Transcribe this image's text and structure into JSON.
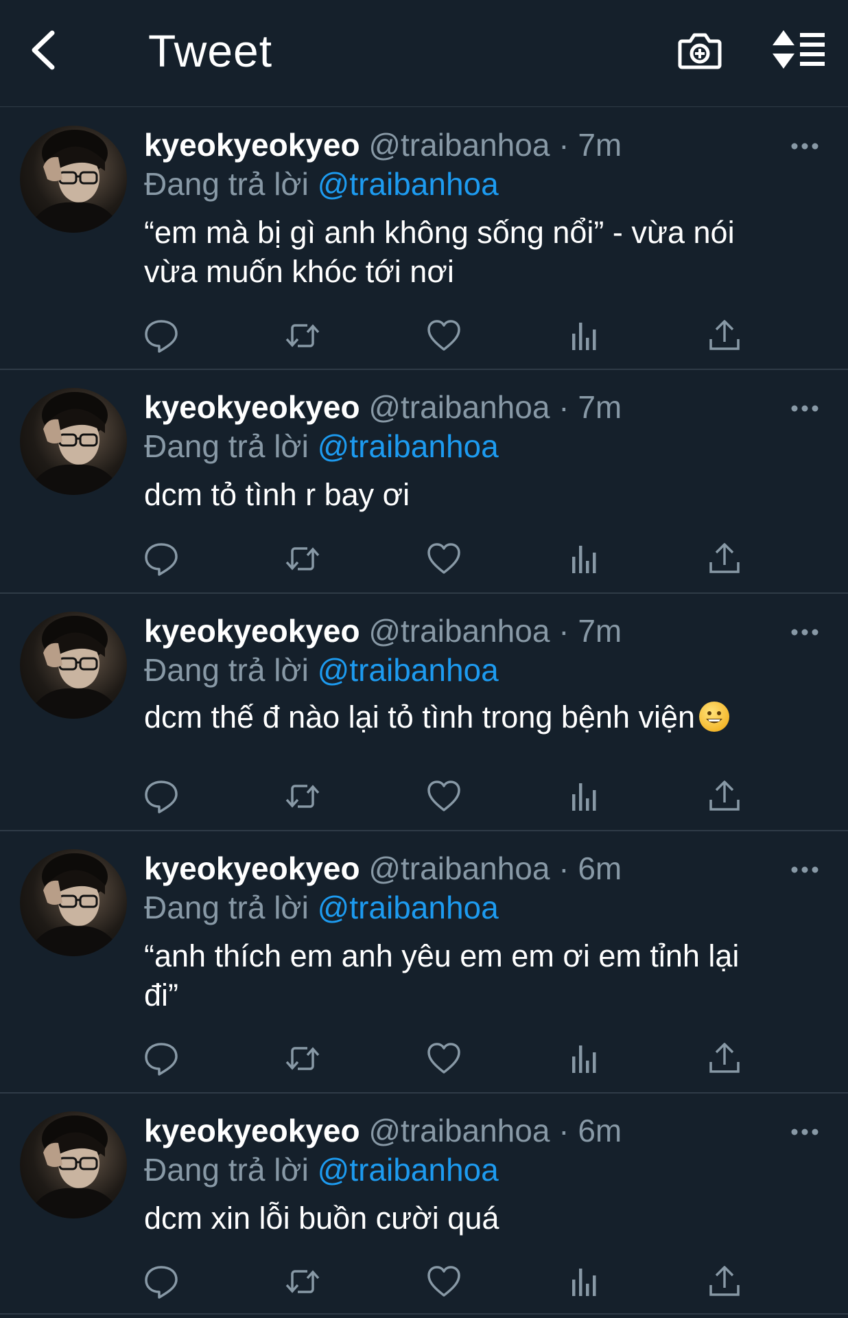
{
  "header": {
    "title": "Tweet",
    "icons": [
      "back-arrow-icon",
      "camera-plus-icon",
      "sort-timeline-icon"
    ]
  },
  "colors": {
    "background": "#15202b",
    "divider": "#2f3b47",
    "secondary_text": "#8899a6",
    "accent": "#1d9bf0"
  },
  "tweets": [
    {
      "name": "kyeokyeokyeo",
      "handle": "@traibanhoa",
      "time": "· 7m",
      "reply_prefix": "Đang trả lời",
      "reply_to": "@traibanhoa",
      "text_lines": [
        "“em mà bị gì anh không sống nổi” - vừa nói",
        "vừa muốn khóc tới nơi"
      ]
    },
    {
      "name": "kyeokyeokyeo",
      "handle": "@traibanhoa",
      "time": "· 7m",
      "reply_prefix": "Đang trả lời",
      "reply_to": "@traibanhoa",
      "text_lines": [
        "dcm tỏ tình r bay ơi"
      ]
    },
    {
      "name": "kyeokyeokyeo",
      "handle": "@traibanhoa",
      "time": "· 7m",
      "reply_prefix": "Đang trả lời",
      "reply_to": "@traibanhoa",
      "text_lines": [
        "dcm thế đ nào lại tỏ tình trong bệnh viện"
      ],
      "emoji": "grinning-face-emoji"
    },
    {
      "name": "kyeokyeokyeo",
      "handle": "@traibanhoa",
      "time": "· 6m",
      "reply_prefix": "Đang trả lời",
      "reply_to": "@traibanhoa",
      "text_lines": [
        "“anh thích em anh yêu em em ơi em tỉnh lại",
        "đi”"
      ]
    },
    {
      "name": "kyeokyeokyeo",
      "handle": "@traibanhoa",
      "time": "· 6m",
      "reply_prefix": "Đang trả lời",
      "reply_to": "@traibanhoa",
      "text_lines": [
        "dcm xin lỗi buồn cười quá"
      ]
    }
  ]
}
